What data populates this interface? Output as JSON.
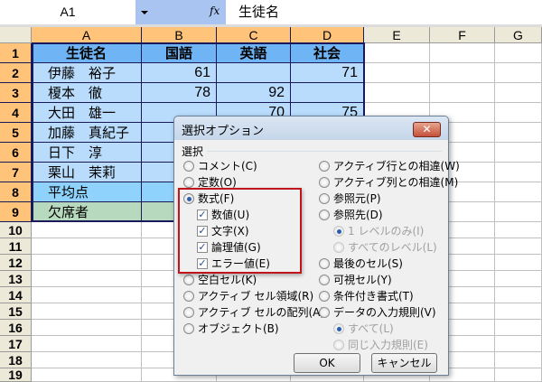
{
  "name_box": "A1",
  "fx_label": "fx",
  "formula_value": "生徒名",
  "columns": [
    "A",
    "B",
    "C",
    "D",
    "E",
    "F",
    "G"
  ],
  "rows": [
    {
      "n": "1",
      "cells": [
        "生徒名",
        "国語",
        "英語",
        "社会"
      ]
    },
    {
      "n": "2",
      "cells": [
        "伊藤　裕子",
        "61",
        "",
        "71"
      ]
    },
    {
      "n": "3",
      "cells": [
        "榎本　徹",
        "78",
        "92",
        ""
      ]
    },
    {
      "n": "4",
      "cells": [
        "大田　雄一",
        "",
        "70",
        "75"
      ]
    },
    {
      "n": "5",
      "cells": [
        "加藤　真紀子",
        "",
        "",
        ""
      ]
    },
    {
      "n": "6",
      "cells": [
        "日下　淳",
        "",
        "",
        ""
      ]
    },
    {
      "n": "7",
      "cells": [
        "栗山　茉莉",
        "",
        "",
        ""
      ]
    },
    {
      "n": "8",
      "cells": [
        "平均点",
        "",
        "",
        ""
      ]
    },
    {
      "n": "9",
      "cells": [
        "欠席者",
        "",
        "",
        ""
      ]
    },
    {
      "n": "10"
    },
    {
      "n": "11"
    },
    {
      "n": "12"
    },
    {
      "n": "13"
    },
    {
      "n": "14"
    },
    {
      "n": "15"
    },
    {
      "n": "16"
    },
    {
      "n": "17"
    },
    {
      "n": "18"
    },
    {
      "n": "19"
    }
  ],
  "colors": {
    "header_fill": "#6fb4f4",
    "data_fill": "#b9dcfc",
    "avg_fill": "#8fd2fc",
    "absent_fill": "#b7dabf",
    "selected_header": "#ffc37a",
    "highlight_box": "#c0151a"
  },
  "dialog": {
    "title": "選択オプション",
    "close": "✕",
    "group_label": "選択",
    "left_options": [
      {
        "label": "コメント(C)",
        "type": "radio"
      },
      {
        "label": "定数(O)",
        "type": "radio"
      },
      {
        "label": "数式(F)",
        "type": "radio",
        "checked": true
      },
      {
        "label": "数値(U)",
        "type": "check",
        "checked": true
      },
      {
        "label": "文字(X)",
        "type": "check",
        "checked": true
      },
      {
        "label": "論理値(G)",
        "type": "check",
        "checked": true
      },
      {
        "label": "エラー値(E)",
        "type": "check",
        "checked": true
      },
      {
        "label": "空白セル(K)",
        "type": "radio"
      },
      {
        "label": "アクティブ セル領域(R)",
        "type": "radio"
      },
      {
        "label": "アクティブ セルの配列(A)",
        "type": "radio"
      },
      {
        "label": "オブジェクト(B)",
        "type": "radio"
      }
    ],
    "right_options": [
      {
        "label": "アクティブ行との相違(W)",
        "type": "radio"
      },
      {
        "label": "アクティブ列との相違(M)",
        "type": "radio"
      },
      {
        "label": "参照元(P)",
        "type": "radio"
      },
      {
        "label": "参照先(D)",
        "type": "radio"
      },
      {
        "label": "1 レベルのみ(I)",
        "type": "radio",
        "sub": true,
        "disabled": true,
        "checked": true
      },
      {
        "label": "すべてのレベル(L)",
        "type": "radio",
        "sub": true,
        "disabled": true
      },
      {
        "label": "最後のセル(S)",
        "type": "radio"
      },
      {
        "label": "可視セル(Y)",
        "type": "radio"
      },
      {
        "label": "条件付き書式(T)",
        "type": "radio"
      },
      {
        "label": "データの入力規則(V)",
        "type": "radio"
      },
      {
        "label": "すべて(L)",
        "type": "radio",
        "sub": true,
        "disabled": true,
        "checked": true
      },
      {
        "label": "同じ入力規則(E)",
        "type": "radio",
        "sub": true,
        "disabled": true
      }
    ],
    "ok": "OK",
    "cancel": "キャンセル"
  }
}
